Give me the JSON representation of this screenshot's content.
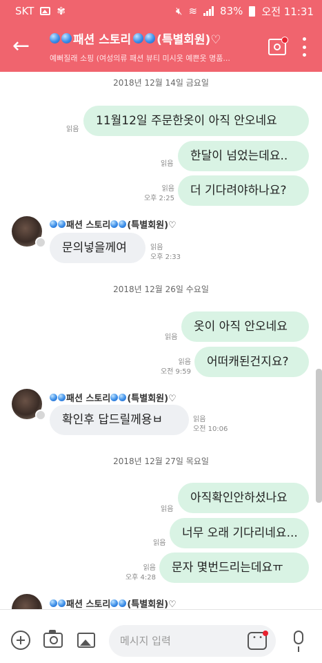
{
  "statusbar": {
    "carrier": "SKT",
    "battery": "83%",
    "time": "오전 11:31"
  },
  "header": {
    "title": "패션 스토리",
    "title_suffix": "(특별회원)♡",
    "subtitle": "예뻐질래 소핑 (여성의류 패션 뷰티 미시옷 예쁜옷 명품..."
  },
  "chat": {
    "dates": [
      "2018년 12월 14일 금요일",
      "2018년 12월 26일 수요일",
      "2018년 12월 27일 목요일"
    ],
    "messages": [
      {
        "text": "11월12일 주문한옷이 아직 안오네요",
        "read": "읽음",
        "time": ""
      },
      {
        "text": "한달이 넘었는데요..",
        "read": "읽음",
        "time": ""
      },
      {
        "text": "더 기다려야하나요?",
        "read": "읽음",
        "time": "오후 2:25"
      },
      {
        "text": "문의넣을께여",
        "read": "읽음",
        "time": "오후 2:33"
      },
      {
        "text": "옷이 아직 안오네요",
        "read": "읽음",
        "time": ""
      },
      {
        "text": "어떠캐된건지요?",
        "read": "읽음",
        "time": "오전 9:59"
      },
      {
        "text": "확인후 답드릴께용ㅂ",
        "read": "읽음",
        "time": "오전 10:06"
      },
      {
        "text": "아직확인안하셨나요",
        "read": "읽음",
        "time": ""
      },
      {
        "text": "너무 오래 기다리네요...",
        "read": "읽음",
        "time": ""
      },
      {
        "text": "문자 몇번드리는데요ㅠ",
        "read": "읽음",
        "time": "오후 4:28"
      }
    ],
    "sender_name": "패션 스토리",
    "sender_suffix": "(특별회원)♡"
  },
  "input": {
    "placeholder": "메시지 입력"
  },
  "colors": {
    "header": "#f0646e",
    "my_bubble": "#d9f3e4",
    "their_bubble": "#eef0f3"
  },
  "icons": [
    "back-arrow-icon",
    "chat-tv-icon",
    "more-vert-icon",
    "plus-icon",
    "camera-icon",
    "image-icon",
    "emoticon-icon",
    "mic-icon"
  ]
}
